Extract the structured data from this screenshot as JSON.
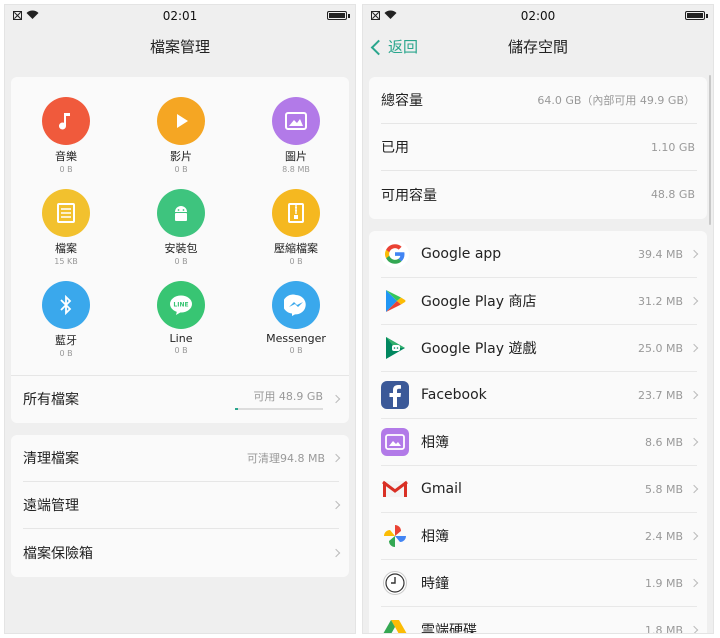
{
  "left": {
    "status_time": "02:01",
    "title": "檔案管理",
    "categories": [
      {
        "label": "音樂",
        "size": "0 B",
        "color": "#f05a3c"
      },
      {
        "label": "影片",
        "size": "0 B",
        "color": "#f5a623"
      },
      {
        "label": "圖片",
        "size": "8.8 MB",
        "color": "#b27ae8"
      },
      {
        "label": "檔案",
        "size": "15 KB",
        "color": "#f2c12e"
      },
      {
        "label": "安裝包",
        "size": "0 B",
        "color": "#3ec47e"
      },
      {
        "label": "壓縮檔案",
        "size": "0 B",
        "color": "#f5b820"
      },
      {
        "label": "藍牙",
        "size": "0 B",
        "color": "#3aa8ec"
      },
      {
        "label": "Line",
        "size": "0 B",
        "color": "#38c573"
      },
      {
        "label": "Messenger",
        "size": "0 B",
        "color": "#3aa8ec"
      }
    ],
    "all_files": {
      "label": "所有檔案",
      "available": "可用 48.9 GB"
    },
    "rows": [
      {
        "label": "清理檔案",
        "value": "可清理94.8 MB"
      },
      {
        "label": "遠端管理",
        "value": ""
      },
      {
        "label": "檔案保險箱",
        "value": ""
      }
    ]
  },
  "right": {
    "status_time": "02:00",
    "back_label": "返回",
    "title": "儲存空間",
    "summary": [
      {
        "label": "總容量",
        "value": "64.0 GB（內部可用 49.9 GB）"
      },
      {
        "label": "已用",
        "value": "1.10 GB"
      },
      {
        "label": "可用容量",
        "value": "48.8 GB"
      }
    ],
    "apps": [
      {
        "name": "Google app",
        "size": "39.4 MB",
        "icon": "google-icon"
      },
      {
        "name": "Google Play 商店",
        "size": "31.2 MB",
        "icon": "play-store-icon"
      },
      {
        "name": "Google Play 遊戲",
        "size": "25.0 MB",
        "icon": "play-games-icon"
      },
      {
        "name": "Facebook",
        "size": "23.7 MB",
        "icon": "facebook-icon"
      },
      {
        "name": "相簿",
        "size": "8.6 MB",
        "icon": "album-icon"
      },
      {
        "name": "Gmail",
        "size": "5.8 MB",
        "icon": "gmail-icon"
      },
      {
        "name": "相簿",
        "size": "2.4 MB",
        "icon": "google-photos-icon"
      },
      {
        "name": "時鐘",
        "size": "1.9 MB",
        "icon": "clock-icon"
      },
      {
        "name": "雲端硬碟",
        "size": "1.8 MB",
        "icon": "drive-icon"
      }
    ]
  }
}
